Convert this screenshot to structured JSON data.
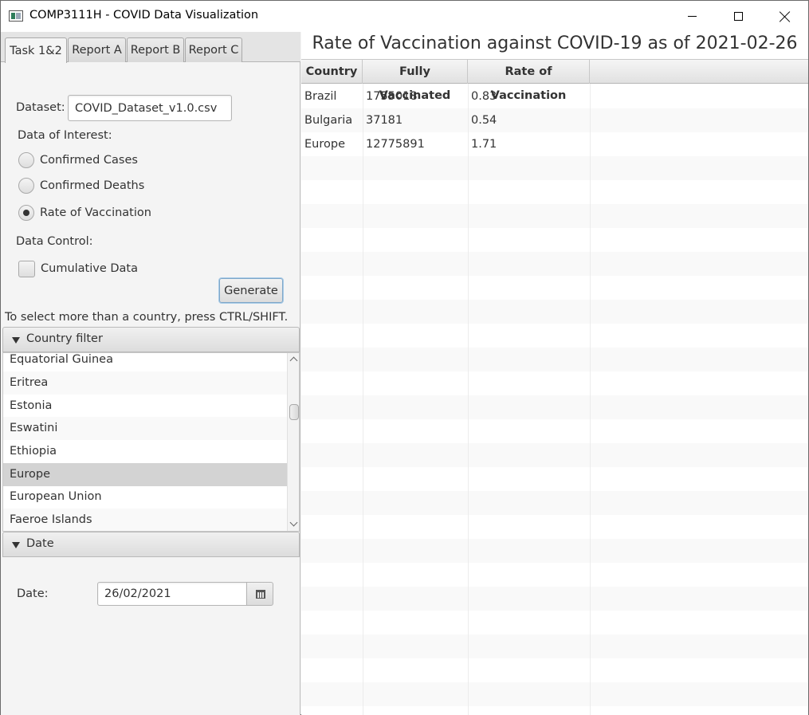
{
  "window": {
    "title": "COMP3111H - COVID Data Visualization"
  },
  "tabs": [
    "Task 1&2",
    "Report A",
    "Report B",
    "Report C"
  ],
  "form": {
    "dataset_label": "Dataset:",
    "dataset_value": "COVID_Dataset_v1.0.csv",
    "interest_label": "Data of Interest:",
    "options": [
      "Confirmed Cases",
      "Confirmed Deaths",
      "Rate of Vaccination"
    ],
    "selected_option": "Rate of Vaccination",
    "control_label": "Data Control:",
    "cumulative_label": "Cumulative Data",
    "cumulative_checked": false,
    "generate_label": "Generate",
    "hint": "To select more than a country, press CTRL/SHIFT."
  },
  "country_filter": {
    "title": "Country filter",
    "items": [
      "Equatorial Guinea",
      "Eritrea",
      "Estonia",
      "Eswatini",
      "Ethiopia",
      "Europe",
      "European Union",
      "Faeroe Islands"
    ],
    "selected": "Europe"
  },
  "date_pane": {
    "title": "Date",
    "label": "Date:",
    "value": "26/02/2021"
  },
  "report": {
    "title": "Rate of Vaccination against COVID-19 as of 2021-02-26",
    "columns": [
      "Country",
      "Fully Vaccinated",
      "Rate of Vaccination"
    ],
    "rows": [
      [
        "Brazil",
        "1755018",
        "0.83"
      ],
      [
        "Bulgaria",
        "37181",
        "0.54"
      ],
      [
        "Europe",
        "12775891",
        "1.71"
      ]
    ]
  }
}
